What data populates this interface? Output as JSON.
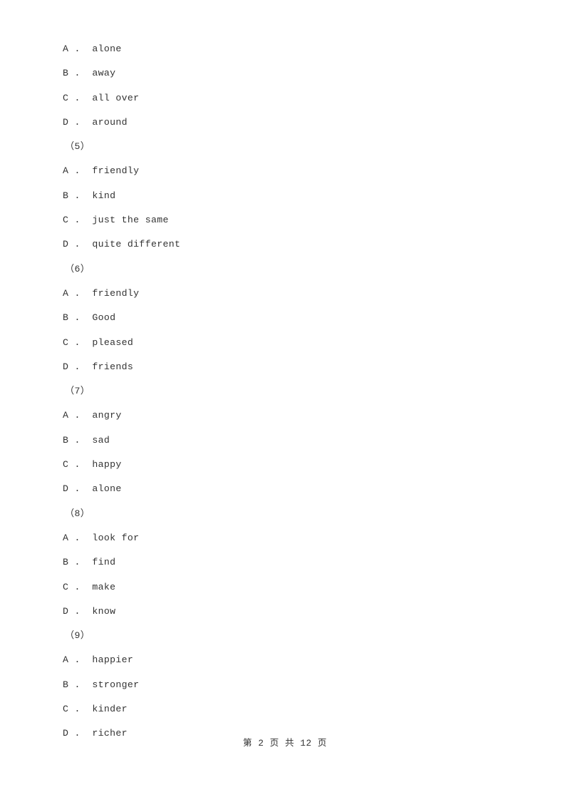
{
  "document": {
    "background_color": "#ffffff",
    "text_color": "#333333",
    "footer": "第 2 页 共 12 页"
  },
  "body_lines": [
    {
      "kind": "option",
      "text": "A .  alone"
    },
    {
      "kind": "option",
      "text": "B .  away"
    },
    {
      "kind": "option",
      "text": "C .  all over"
    },
    {
      "kind": "option",
      "text": "D .  around"
    },
    {
      "kind": "qnum",
      "text": "（5）"
    },
    {
      "kind": "option",
      "text": "A .  friendly"
    },
    {
      "kind": "option",
      "text": "B .  kind"
    },
    {
      "kind": "option",
      "text": "C .  just the same"
    },
    {
      "kind": "option",
      "text": "D .  quite different"
    },
    {
      "kind": "qnum",
      "text": "（6）"
    },
    {
      "kind": "option",
      "text": "A .  friendly"
    },
    {
      "kind": "option",
      "text": "B .  Good"
    },
    {
      "kind": "option",
      "text": "C .  pleased"
    },
    {
      "kind": "option",
      "text": "D .  friends"
    },
    {
      "kind": "qnum",
      "text": "（7）"
    },
    {
      "kind": "option",
      "text": "A .  angry"
    },
    {
      "kind": "option",
      "text": "B .  sad"
    },
    {
      "kind": "option",
      "text": "C .  happy"
    },
    {
      "kind": "option",
      "text": "D .  alone"
    },
    {
      "kind": "qnum",
      "text": "（8）"
    },
    {
      "kind": "option",
      "text": "A .  look for"
    },
    {
      "kind": "option",
      "text": "B .  find"
    },
    {
      "kind": "option",
      "text": "C .  make"
    },
    {
      "kind": "option",
      "text": "D .  know"
    },
    {
      "kind": "qnum",
      "text": "（9）"
    },
    {
      "kind": "option",
      "text": "A .  happier"
    },
    {
      "kind": "option",
      "text": "B .  stronger"
    },
    {
      "kind": "option",
      "text": "C .  kinder"
    },
    {
      "kind": "option",
      "text": "D .  richer"
    }
  ]
}
